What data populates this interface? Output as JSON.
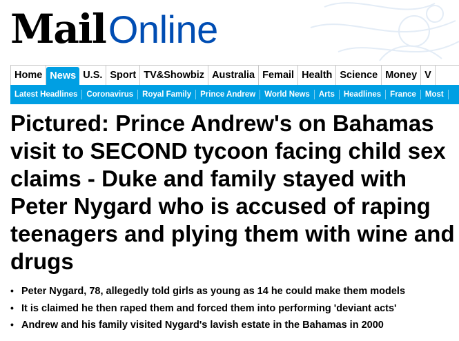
{
  "logo": {
    "brand": "Mail",
    "suffix": "Online"
  },
  "colors": {
    "brand_blue": "#004db3",
    "nav_blue": "#009fe3"
  },
  "primary_nav": [
    {
      "label": "Home",
      "active": false
    },
    {
      "label": "News",
      "active": true
    },
    {
      "label": "U.S.",
      "active": false
    },
    {
      "label": "Sport",
      "active": false
    },
    {
      "label": "TV&Showbiz",
      "active": false
    },
    {
      "label": "Australia",
      "active": false
    },
    {
      "label": "Femail",
      "active": false
    },
    {
      "label": "Health",
      "active": false
    },
    {
      "label": "Science",
      "active": false
    },
    {
      "label": "Money",
      "active": false
    },
    {
      "label": "V",
      "active": false
    }
  ],
  "secondary_nav": [
    "Latest Headlines",
    "Coronavirus",
    "Royal Family",
    "Prince Andrew",
    "World News",
    "Arts",
    "Headlines",
    "France",
    "Most"
  ],
  "article": {
    "headline": "Pictured: Prince Andrew's on Bahamas visit to SECOND tycoon facing child sex claims - Duke and family stayed with Peter Nygard who is accused of raping teenagers and plying them with wine and drugs",
    "bullets": [
      "Peter Nygard, 78, allegedly told girls as young as 14 he could make them models",
      "It is claimed he then raped them and forced them into performing 'deviant acts'",
      "Andrew and his family visited Nygard's lavish estate in the Bahamas in 2000"
    ]
  }
}
